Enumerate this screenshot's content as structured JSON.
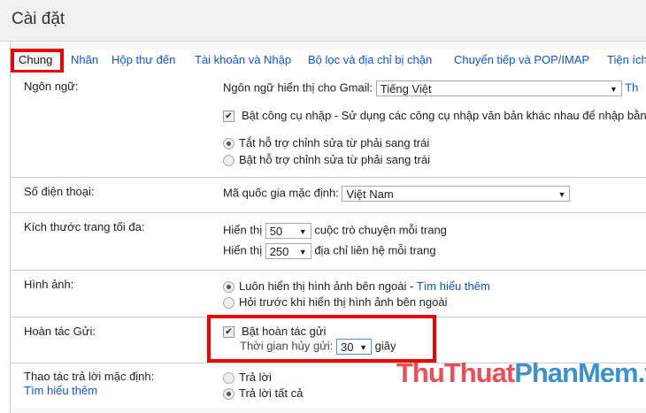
{
  "header": {
    "title": "Cài đặt"
  },
  "tabs": [
    "Chung",
    "Nhãn",
    "Hộp thư đến",
    "Tài khoản và Nhập",
    "Bộ lọc và địa chỉ bị chặn",
    "Chuyển tiếp và POP/IMAP",
    "Tiện ích"
  ],
  "language": {
    "label": "Ngôn ngữ:",
    "display_label": "Ngôn ngữ hiển thị cho Gmail:",
    "display_value": "Tiếng Việt",
    "more_link": "Th",
    "input_tools_label": "Bật công cụ nhập",
    "input_tools_desc": " - Sử dụng các công cụ nhập văn bản khác nhau để nhập bằng",
    "rtl_off": "Tắt hỗ trợ chỉnh sửa từ phải sang trái",
    "rtl_on": "Bật hỗ trợ chỉnh sửa từ phải sang trái"
  },
  "phone": {
    "label": "Số điện thoại:",
    "country_label": "Mã quốc gia mặc định:",
    "country_value": "Việt Nam"
  },
  "page_size": {
    "label": "Kích thước trang tối đa:",
    "show": "Hiển thị",
    "conv_value": "50",
    "conv_text": "cuộc trò chuyện mỗi trang",
    "contacts_value": "250",
    "contacts_text": "địa chỉ liên hệ mỗi trang"
  },
  "images": {
    "label": "Hình ảnh:",
    "always": "Luôn hiển thị hình ảnh bên ngoài - ",
    "learn_more": "Tìm hiểu thêm",
    "ask": "Hỏi trước khi hiển thị hình ảnh bên ngoài"
  },
  "undo": {
    "label": "Hoàn tác Gửi:",
    "enable": "Bật hoàn tác gửi",
    "period_label": "Thời gian hủy gửi:",
    "period_value": "30",
    "unit": "giây"
  },
  "reply": {
    "label": "Thao tác trả lời mặc định:",
    "learn_more": "Tìm hiểu thêm",
    "reply": "Trả lời",
    "reply_all": "Trả lời tất cả"
  },
  "watermark": {
    "part1": "ThuThuat",
    "part2": "PhanMem",
    "part3": ".vn",
    "color1": "#e8303a",
    "color2": "#1a7fc8"
  }
}
